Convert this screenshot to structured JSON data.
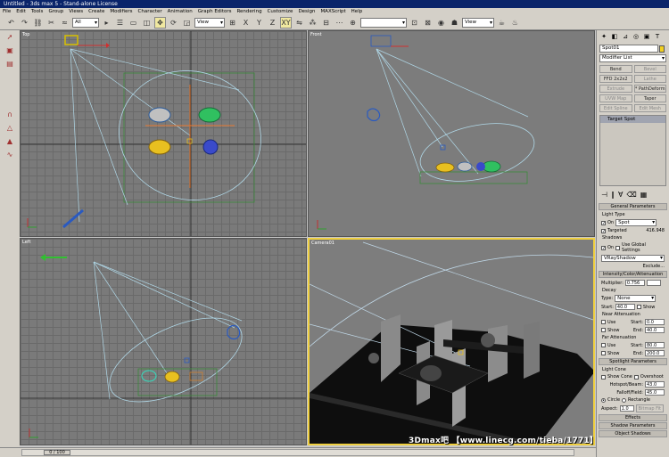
{
  "window": {
    "title": "Untitled - 3ds max 5 - Stand-alone License"
  },
  "menu": [
    "File",
    "Edit",
    "Tools",
    "Group",
    "Views",
    "Create",
    "Modifiers",
    "Character",
    "Animation",
    "Graph Editors",
    "Rendering",
    "Customize",
    "Design",
    "MAXScript",
    "Help"
  ],
  "toolbar": {
    "selection_filter": "All",
    "ref_coord": "View",
    "axis_x": "X",
    "axis_y": "Y",
    "axis_z": "Z",
    "axis_xy": "XY",
    "coord2": "View"
  },
  "viewports": {
    "top": "Top",
    "front": "Front",
    "left": "Left",
    "persp": "Camera01"
  },
  "cmdpanel": {
    "object_name": "Spot01",
    "modifier_list": "Modifier List",
    "modifiers": [
      {
        "label": "Bend",
        "disabled": false
      },
      {
        "label": "Bevel",
        "disabled": true
      },
      {
        "label": "FFD 2x2x2",
        "disabled": false
      },
      {
        "label": "Lathe",
        "disabled": true
      },
      {
        "label": "Extrude",
        "disabled": true
      },
      {
        "label": "* PathDeform",
        "disabled": false
      },
      {
        "label": "UVW Map",
        "disabled": true
      },
      {
        "label": "Taper",
        "disabled": false
      },
      {
        "label": "Edit Spline",
        "disabled": true
      },
      {
        "label": "Edit Mesh",
        "disabled": true
      }
    ],
    "stack_item": "Target Spot",
    "general": {
      "header": "General Parameters",
      "light_type": "Light Type",
      "on_label": "On",
      "type_value": "Spot",
      "targeted_label": "Targeted",
      "targeted_value": "416.948",
      "shadows": "Shadows",
      "use_global": "Use Global Settings",
      "shadow_type": "VRayShadow",
      "exclude": "Exclude..."
    },
    "intensity": {
      "header": "Intensity/Color/Attenuation",
      "multiplier_label": "Multiplier:",
      "multiplier_value": "0.756",
      "decay": "Decay",
      "type_label": "Type:",
      "type_value": "None",
      "start_label": "Start:",
      "start_value": "40.0",
      "show": "Show",
      "near": "Near Attenuation",
      "near_use": "Use",
      "near_start": "0.0",
      "near_show": "Show",
      "near_end_label": "End:",
      "near_end": "40.0",
      "far": "Far Attenuation",
      "far_use": "Use",
      "far_start": "80.0",
      "far_show": "Show",
      "far_end_label": "End:",
      "far_end": "200.0"
    },
    "spot": {
      "header": "Spotlight Parameters",
      "light_cone": "Light Cone",
      "show_cone": "Show Cone",
      "overshoot": "Overshoot",
      "hotspot_label": "Hotspot/Beam:",
      "hotspot_value": "43.0",
      "falloff_label": "Falloff/Field:",
      "falloff_value": "45.0",
      "circle": "Circle",
      "rectangle": "Rectangle",
      "aspect_label": "Aspect:",
      "aspect_value": "1.0",
      "bitmap_fit": "Bitmap Fit"
    },
    "effects": "Effects",
    "adv_shadow": "Shadow Parameters",
    "object_shadow": "Object Shadows"
  },
  "status": {
    "time": "0 / 100"
  },
  "watermark": "3Dmax吧 【www.linecg.com/tieba/1771】",
  "colors": {
    "titlebar": "#0a246a",
    "viewport_bg": "#7a7a7a",
    "active_border": "#f0d040",
    "object_swatch": "#f2d020"
  }
}
